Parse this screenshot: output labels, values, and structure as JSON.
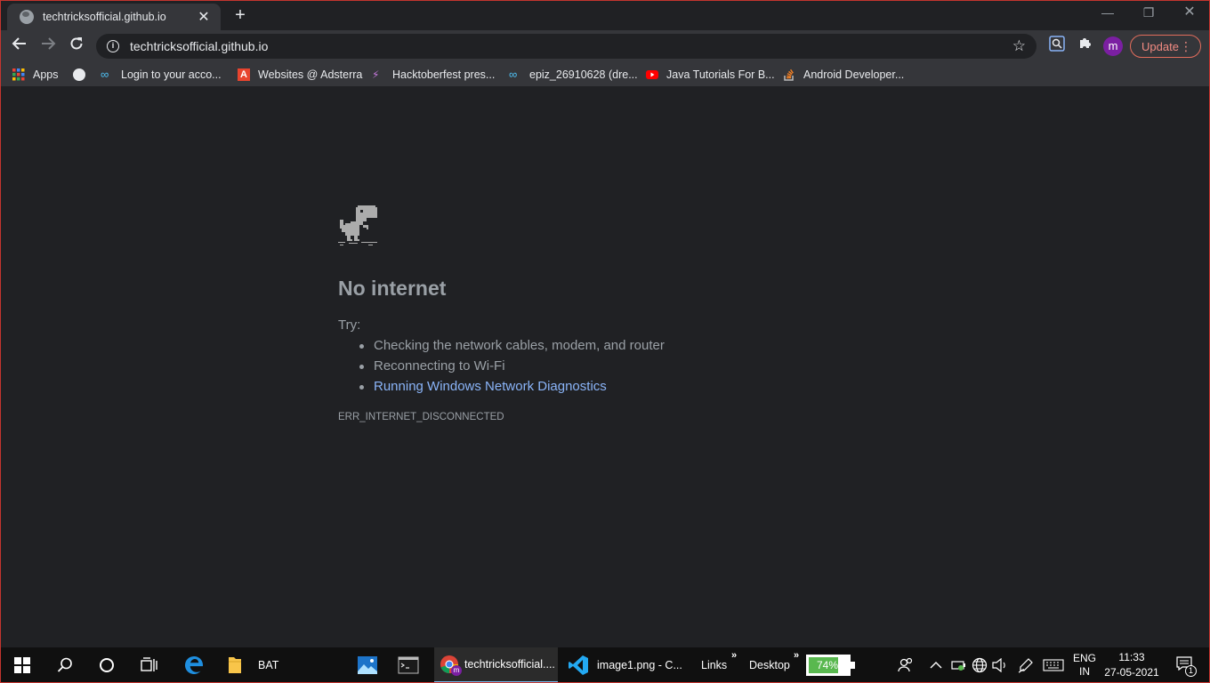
{
  "window": {
    "tab_title": "techtricksofficial.github.io",
    "new_tab": "+",
    "minimize": "—",
    "restore": "❐",
    "close": "✕"
  },
  "toolbar": {
    "url": "techtricksofficial.github.io",
    "update_label": "Update",
    "avatar_letter": "m"
  },
  "bookmarks": [
    {
      "label": "Apps",
      "icon": "apps-grid-icon"
    },
    {
      "label": "",
      "icon": "globe-icon"
    },
    {
      "label": "Login to your acco...",
      "icon": "infinity-icon"
    },
    {
      "label": "Websites @ Adsterra",
      "icon": "adsterra-icon"
    },
    {
      "label": "Hacktoberfest pres...",
      "icon": "hacktoberfest-icon"
    },
    {
      "label": "epiz_26910628 (dre...",
      "icon": "infinity-icon"
    },
    {
      "label": "Java Tutorials For B...",
      "icon": "youtube-icon"
    },
    {
      "label": "Android Developer...",
      "icon": "stackoverflow-icon"
    }
  ],
  "error_page": {
    "title": "No internet",
    "try_label": "Try:",
    "suggestions": [
      "Checking the network cables, modem, and router",
      "Reconnecting to Wi-Fi",
      "Running Windows Network Diagnostics"
    ],
    "error_code": "ERR_INTERNET_DISCONNECTED"
  },
  "taskbar": {
    "apps": [
      {
        "label": "BAT"
      },
      {
        "label": "techtricksofficial...."
      },
      {
        "label": "image1.png - C..."
      }
    ],
    "toolbars": [
      "Links",
      "Desktop"
    ],
    "battery_percent": "74%",
    "battery_level": 0.74,
    "language_top": "ENG",
    "language_bottom": "IN",
    "time": "11:33",
    "date": "27-05-2021",
    "notification_count": "1"
  },
  "colors": {
    "accent_link": "#8ab4f8",
    "update_border": "#e26d5c",
    "battery_fill": "#59b84f"
  }
}
